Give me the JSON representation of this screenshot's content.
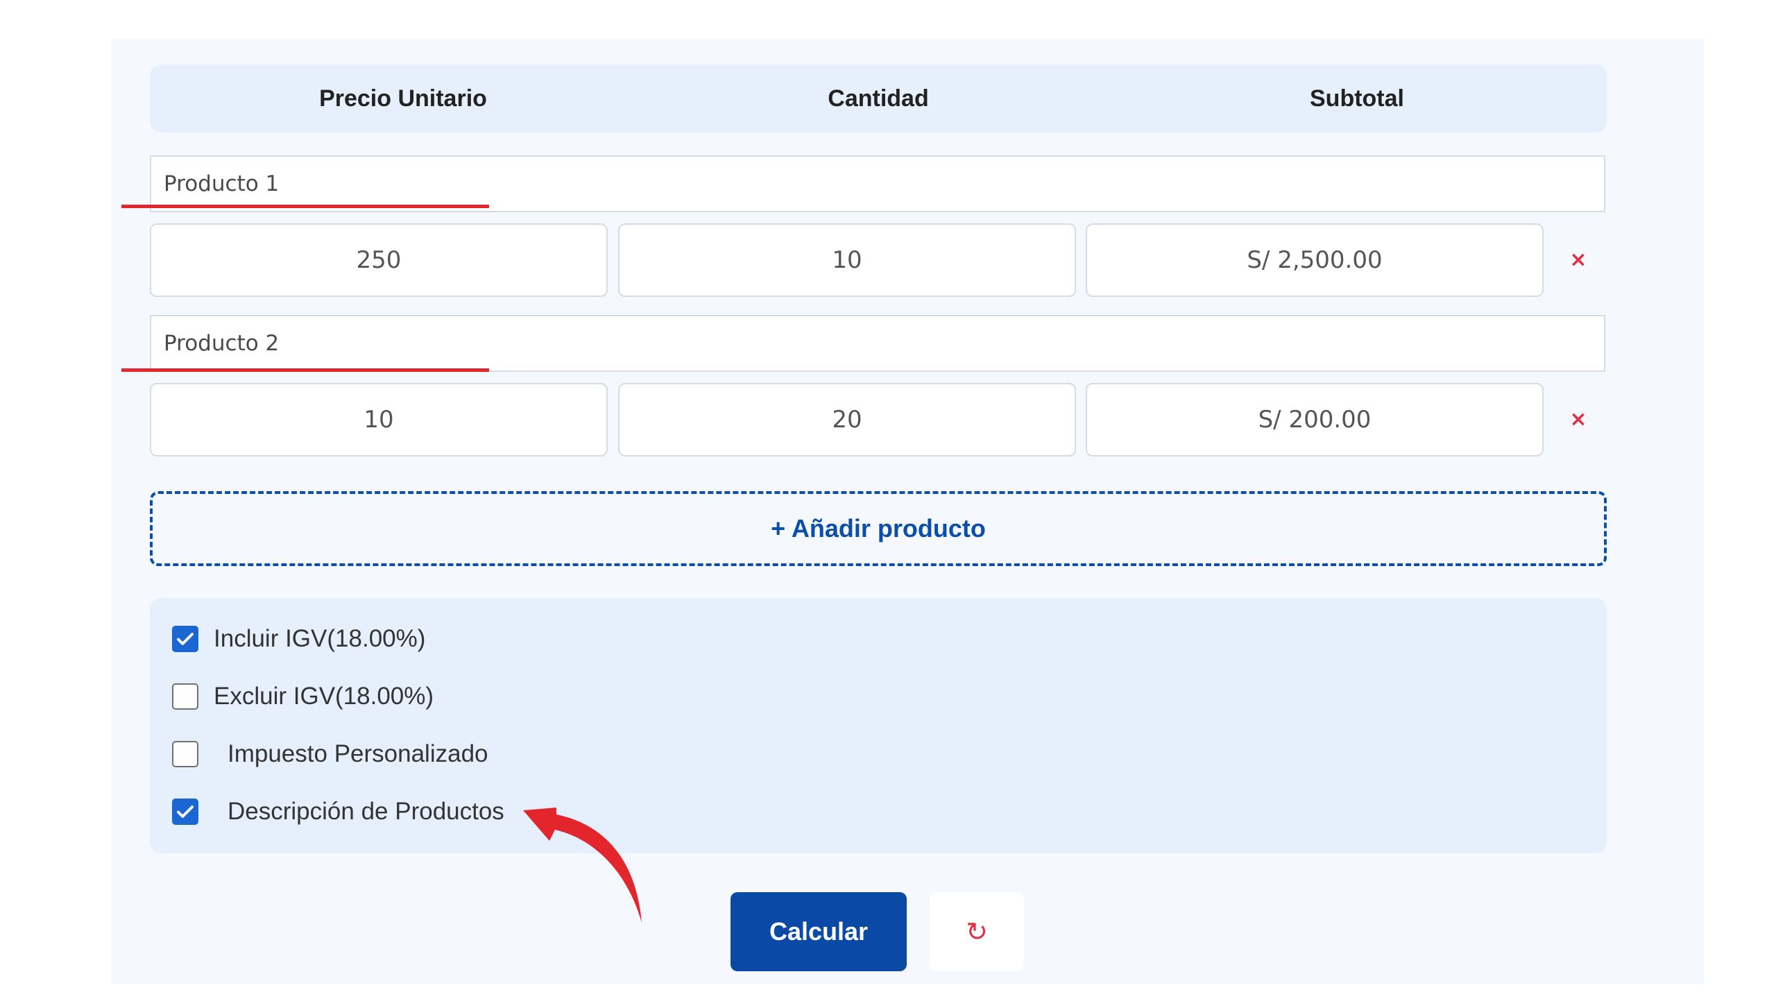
{
  "table": {
    "headers": [
      "Precio Unitario",
      "Cantidad",
      "Subtotal"
    ],
    "products": [
      {
        "name": "Producto 1",
        "price": "250",
        "quantity": "10",
        "subtotal": "S/ 2,500.00",
        "remove": "×"
      },
      {
        "name": "Producto 2",
        "price": "10",
        "quantity": "20",
        "subtotal": "S/ 200.00",
        "remove": "×"
      }
    ]
  },
  "add_product": "+ Añadir producto",
  "options": [
    {
      "label": "Incluir IGV(18.00%)",
      "checked": true
    },
    {
      "label": "Excluir IGV(18.00%)",
      "checked": false
    },
    {
      "label": "Impuesto Personalizado",
      "checked": false
    },
    {
      "label": "Descripción de Productos",
      "checked": true
    }
  ],
  "actions": {
    "calculate": "Calcular",
    "reset": "↻"
  },
  "colors": {
    "primary": "#0a4aa6",
    "checkbox": "#1a66d2",
    "danger": "#e03040",
    "annotation": "#e2262c"
  }
}
